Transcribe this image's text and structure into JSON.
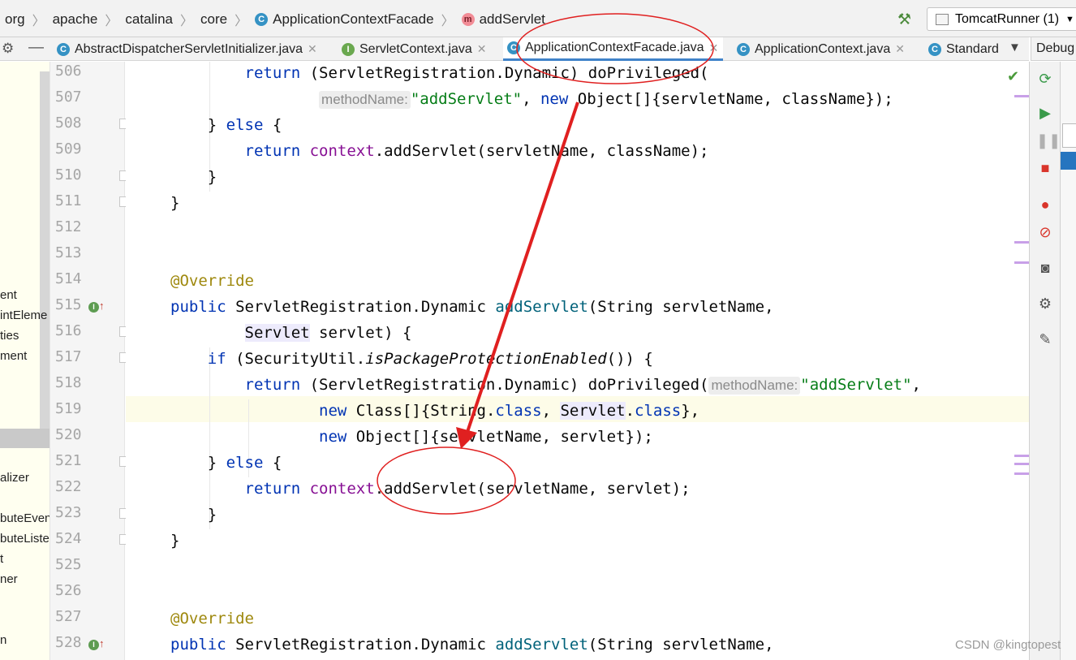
{
  "breadcrumb": {
    "items": [
      "org",
      "apache",
      "catalina",
      "core",
      "ApplicationContextFacade",
      "addServlet"
    ]
  },
  "toolbar": {
    "run_config": "TomcatRunner (1)"
  },
  "tabs": [
    {
      "label": "AbstractDispatcherServletInitializer.java",
      "icon": "C",
      "active": false
    },
    {
      "label": "ServletContext.java",
      "icon": "I",
      "active": false
    },
    {
      "label": "ApplicationContextFacade.java",
      "icon": "C",
      "active": true
    },
    {
      "label": "ApplicationContext.java",
      "icon": "C",
      "active": false
    },
    {
      "label": "Standard",
      "icon": "C",
      "active": false
    }
  ],
  "debug_panel": {
    "title": "Debug"
  },
  "project_panel": {
    "items": [
      "ent",
      "intEleme",
      "ties",
      "ment",
      "alizer",
      "buteEven",
      "buteListe",
      "t",
      "ner",
      "n"
    ]
  },
  "editor": {
    "line_numbers": [
      "506",
      "507",
      "508",
      "509",
      "510",
      "511",
      "512",
      "513",
      "514",
      "515",
      "516",
      "517",
      "518",
      "519",
      "520",
      "521",
      "522",
      "523",
      "524",
      "525",
      "526",
      "527",
      "528"
    ],
    "hints": {
      "method_name": "methodName:"
    },
    "strings": {
      "add_servlet": "\"addServlet\""
    }
  },
  "watermark": "CSDN @kingtopest",
  "colors": {
    "keyword": "#0033b3",
    "string": "#067d17",
    "annotation": "#9e880d",
    "field": "#871094",
    "method": "#00627a",
    "callout_red": "#e02020"
  }
}
